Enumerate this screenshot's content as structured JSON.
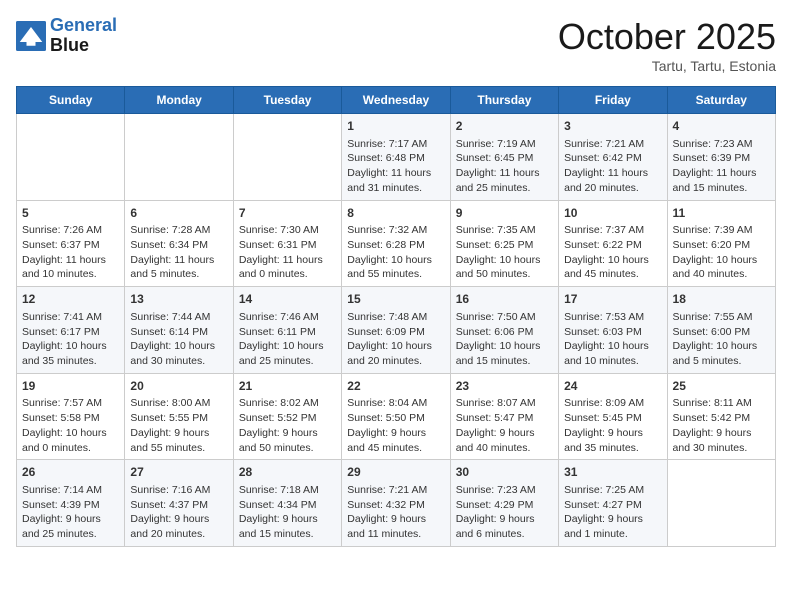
{
  "app": {
    "logo_line1": "General",
    "logo_line2": "Blue",
    "title": "October 2025",
    "subtitle": "Tartu, Tartu, Estonia"
  },
  "days_of_week": [
    "Sunday",
    "Monday",
    "Tuesday",
    "Wednesday",
    "Thursday",
    "Friday",
    "Saturday"
  ],
  "weeks": [
    [
      {
        "day": "",
        "info": ""
      },
      {
        "day": "",
        "info": ""
      },
      {
        "day": "",
        "info": ""
      },
      {
        "day": "1",
        "info": "Sunrise: 7:17 AM\nSunset: 6:48 PM\nDaylight: 11 hours\nand 31 minutes."
      },
      {
        "day": "2",
        "info": "Sunrise: 7:19 AM\nSunset: 6:45 PM\nDaylight: 11 hours\nand 25 minutes."
      },
      {
        "day": "3",
        "info": "Sunrise: 7:21 AM\nSunset: 6:42 PM\nDaylight: 11 hours\nand 20 minutes."
      },
      {
        "day": "4",
        "info": "Sunrise: 7:23 AM\nSunset: 6:39 PM\nDaylight: 11 hours\nand 15 minutes."
      }
    ],
    [
      {
        "day": "5",
        "info": "Sunrise: 7:26 AM\nSunset: 6:37 PM\nDaylight: 11 hours\nand 10 minutes."
      },
      {
        "day": "6",
        "info": "Sunrise: 7:28 AM\nSunset: 6:34 PM\nDaylight: 11 hours\nand 5 minutes."
      },
      {
        "day": "7",
        "info": "Sunrise: 7:30 AM\nSunset: 6:31 PM\nDaylight: 11 hours\nand 0 minutes."
      },
      {
        "day": "8",
        "info": "Sunrise: 7:32 AM\nSunset: 6:28 PM\nDaylight: 10 hours\nand 55 minutes."
      },
      {
        "day": "9",
        "info": "Sunrise: 7:35 AM\nSunset: 6:25 PM\nDaylight: 10 hours\nand 50 minutes."
      },
      {
        "day": "10",
        "info": "Sunrise: 7:37 AM\nSunset: 6:22 PM\nDaylight: 10 hours\nand 45 minutes."
      },
      {
        "day": "11",
        "info": "Sunrise: 7:39 AM\nSunset: 6:20 PM\nDaylight: 10 hours\nand 40 minutes."
      }
    ],
    [
      {
        "day": "12",
        "info": "Sunrise: 7:41 AM\nSunset: 6:17 PM\nDaylight: 10 hours\nand 35 minutes."
      },
      {
        "day": "13",
        "info": "Sunrise: 7:44 AM\nSunset: 6:14 PM\nDaylight: 10 hours\nand 30 minutes."
      },
      {
        "day": "14",
        "info": "Sunrise: 7:46 AM\nSunset: 6:11 PM\nDaylight: 10 hours\nand 25 minutes."
      },
      {
        "day": "15",
        "info": "Sunrise: 7:48 AM\nSunset: 6:09 PM\nDaylight: 10 hours\nand 20 minutes."
      },
      {
        "day": "16",
        "info": "Sunrise: 7:50 AM\nSunset: 6:06 PM\nDaylight: 10 hours\nand 15 minutes."
      },
      {
        "day": "17",
        "info": "Sunrise: 7:53 AM\nSunset: 6:03 PM\nDaylight: 10 hours\nand 10 minutes."
      },
      {
        "day": "18",
        "info": "Sunrise: 7:55 AM\nSunset: 6:00 PM\nDaylight: 10 hours\nand 5 minutes."
      }
    ],
    [
      {
        "day": "19",
        "info": "Sunrise: 7:57 AM\nSunset: 5:58 PM\nDaylight: 10 hours\nand 0 minutes."
      },
      {
        "day": "20",
        "info": "Sunrise: 8:00 AM\nSunset: 5:55 PM\nDaylight: 9 hours\nand 55 minutes."
      },
      {
        "day": "21",
        "info": "Sunrise: 8:02 AM\nSunset: 5:52 PM\nDaylight: 9 hours\nand 50 minutes."
      },
      {
        "day": "22",
        "info": "Sunrise: 8:04 AM\nSunset: 5:50 PM\nDaylight: 9 hours\nand 45 minutes."
      },
      {
        "day": "23",
        "info": "Sunrise: 8:07 AM\nSunset: 5:47 PM\nDaylight: 9 hours\nand 40 minutes."
      },
      {
        "day": "24",
        "info": "Sunrise: 8:09 AM\nSunset: 5:45 PM\nDaylight: 9 hours\nand 35 minutes."
      },
      {
        "day": "25",
        "info": "Sunrise: 8:11 AM\nSunset: 5:42 PM\nDaylight: 9 hours\nand 30 minutes."
      }
    ],
    [
      {
        "day": "26",
        "info": "Sunrise: 7:14 AM\nSunset: 4:39 PM\nDaylight: 9 hours\nand 25 minutes."
      },
      {
        "day": "27",
        "info": "Sunrise: 7:16 AM\nSunset: 4:37 PM\nDaylight: 9 hours\nand 20 minutes."
      },
      {
        "day": "28",
        "info": "Sunrise: 7:18 AM\nSunset: 4:34 PM\nDaylight: 9 hours\nand 15 minutes."
      },
      {
        "day": "29",
        "info": "Sunrise: 7:21 AM\nSunset: 4:32 PM\nDaylight: 9 hours\nand 11 minutes."
      },
      {
        "day": "30",
        "info": "Sunrise: 7:23 AM\nSunset: 4:29 PM\nDaylight: 9 hours\nand 6 minutes."
      },
      {
        "day": "31",
        "info": "Sunrise: 7:25 AM\nSunset: 4:27 PM\nDaylight: 9 hours\nand 1 minute."
      },
      {
        "day": "",
        "info": ""
      }
    ]
  ]
}
